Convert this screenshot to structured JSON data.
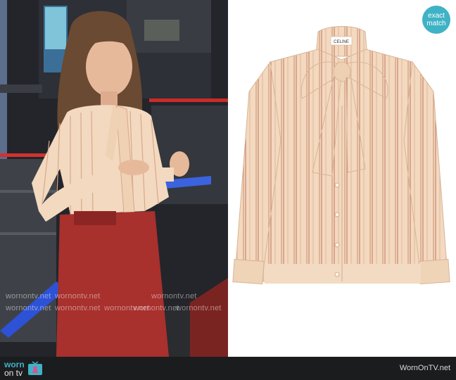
{
  "badge": {
    "line1": "exact",
    "line2": "match"
  },
  "brand_label": "CELINE",
  "watermark": {
    "row1": [
      "wornontv.net",
      "wornontv.net",
      "wornontv.net"
    ],
    "row2": [
      "wornontv.net",
      "wornontv.net",
      "wornontv.net",
      "wornontv.net",
      "wornontv.net"
    ]
  },
  "footer": {
    "logo_line1": "worn",
    "logo_line2": "on tv",
    "site": "WornOnTV.net"
  },
  "colors": {
    "badge": "#3fb2c6",
    "footer": "#1b1c1e",
    "blouse": "#f3d9bf",
    "skirt": "#a8302d"
  }
}
